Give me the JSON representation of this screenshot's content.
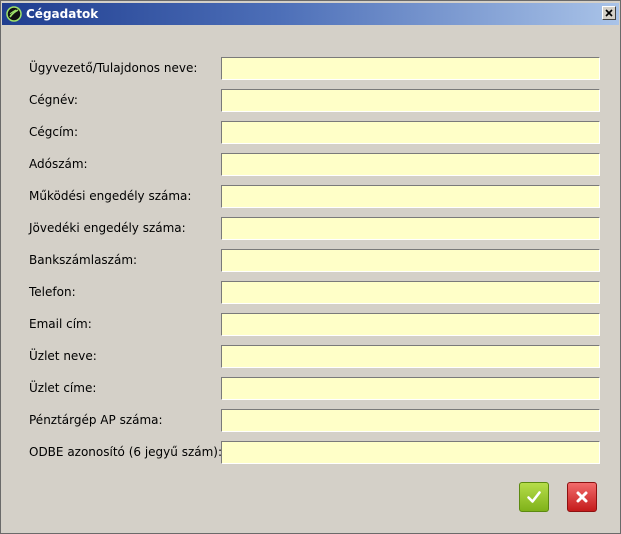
{
  "window": {
    "title": "Cégadatok"
  },
  "fields": [
    {
      "label": "Ügyvezető/Tulajdonos neve:",
      "value": ""
    },
    {
      "label": "Cégnév:",
      "value": ""
    },
    {
      "label": "Cégcím:",
      "value": ""
    },
    {
      "label": "Adószám:",
      "value": ""
    },
    {
      "label": "Működési engedély száma:",
      "value": ""
    },
    {
      "label": "Jövedéki engedély száma:",
      "value": ""
    },
    {
      "label": "Bankszámlaszám:",
      "value": ""
    },
    {
      "label": "Telefon:",
      "value": ""
    },
    {
      "label": "Email cím:",
      "value": ""
    },
    {
      "label": "Üzlet neve:",
      "value": ""
    },
    {
      "label": "Üzlet címe:",
      "value": ""
    },
    {
      "label": "Pénztárgép AP száma:",
      "value": ""
    },
    {
      "label": "ODBE azonosító (6 jegyű szám):",
      "value": ""
    }
  ],
  "colors": {
    "input_bg": "#ffffc8",
    "ok_button": "#8cc21f",
    "cancel_button": "#d92c2c"
  },
  "icons": {
    "app": "circled-slash-icon",
    "close": "close-icon",
    "ok": "checkmark-icon",
    "cancel": "cross-icon"
  }
}
